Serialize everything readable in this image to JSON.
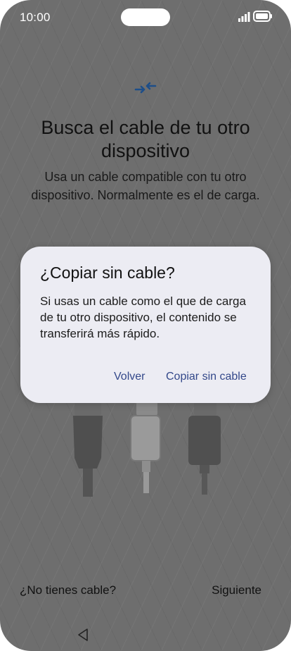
{
  "status_bar": {
    "time": "10:00"
  },
  "screen": {
    "title": "Busca el cable de tu otro dispositivo",
    "subtitle": "Usa un cable compatible con tu otro dispositivo. Normalmente es el de carga.",
    "no_cable_link": "¿No tienes cable?",
    "next_button": "Siguiente"
  },
  "dialog": {
    "title": "¿Copiar sin cable?",
    "body": "Si usas un cable como el que de carga de tu otro dispositivo, el contenido se transferirá más rápido.",
    "back_button": "Volver",
    "copy_button": "Copiar sin cable"
  },
  "colors": {
    "accent": "#33488a",
    "icon_blue": "#1d4e89",
    "overlay": "#6e6e6e",
    "dialog_bg": "#ececf3"
  },
  "icons": [
    "signal-icon",
    "battery-icon",
    "transfer-arrows-icon",
    "cables-illustration",
    "nav-back-icon"
  ]
}
